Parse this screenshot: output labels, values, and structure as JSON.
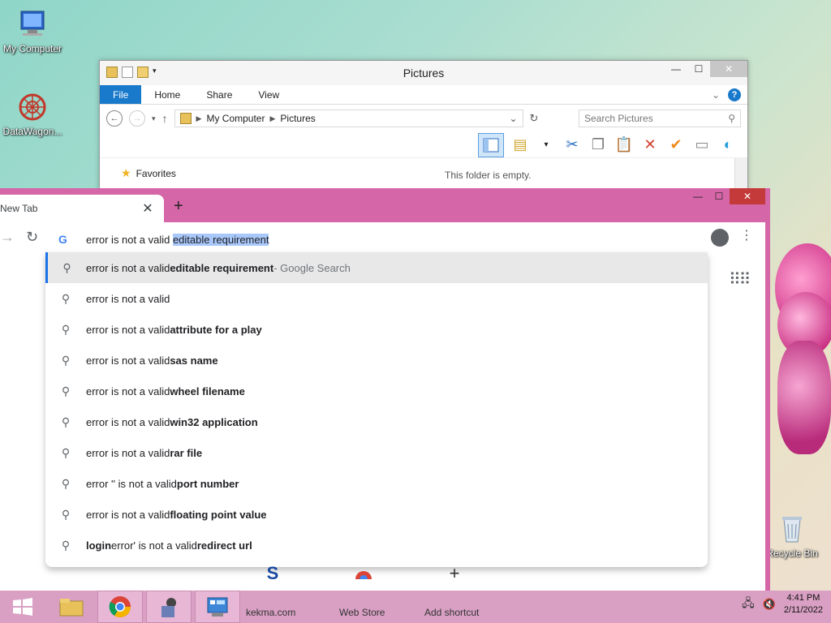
{
  "desktop": {
    "icons": [
      {
        "label": "My Computer"
      },
      {
        "label": "DataWagon..."
      },
      {
        "label": "Recycle Bin"
      }
    ]
  },
  "explorer": {
    "title": "Pictures",
    "ribbon_tabs": [
      "File",
      "Home",
      "Share",
      "View"
    ],
    "breadcrumb": [
      "My Computer",
      "Pictures"
    ],
    "search_placeholder": "Search Pictures",
    "favorites_label": "Favorites",
    "empty_message": "This folder is empty."
  },
  "chrome": {
    "tab_title": "New Tab",
    "omnibox": {
      "typed": "error is not a valid ",
      "autocomplete": "editable requirement"
    },
    "suggestions": [
      {
        "plain": "error is not a valid ",
        "bold": "editable requirement",
        "suffix": " - Google Search"
      },
      {
        "plain": "error is not a valid",
        "bold": "",
        "suffix": ""
      },
      {
        "plain": "error is not a valid ",
        "bold": "attribute for a play",
        "suffix": ""
      },
      {
        "plain": "error is not a valid ",
        "bold": "sas name",
        "suffix": ""
      },
      {
        "plain": "error is not a valid ",
        "bold": "wheel filename",
        "suffix": ""
      },
      {
        "plain": "error is not a valid ",
        "bold": "win32 application",
        "suffix": ""
      },
      {
        "plain": "error is not a valid ",
        "bold": "rar file",
        "suffix": ""
      },
      {
        "plain": "error '' is not a valid ",
        "bold": "port number",
        "suffix": ""
      },
      {
        "plain": "error is not a valid ",
        "bold": "floating point value",
        "suffix": ""
      },
      {
        "lead_bold": "login",
        "plain": " error' is not a valid ",
        "bold": "redirect url",
        "suffix": ""
      }
    ],
    "shortcuts": [
      "kekma.com",
      "Web Store",
      "Add shortcut"
    ]
  },
  "taskbar": {
    "time": "4:41 PM",
    "date": "2/11/2022"
  }
}
